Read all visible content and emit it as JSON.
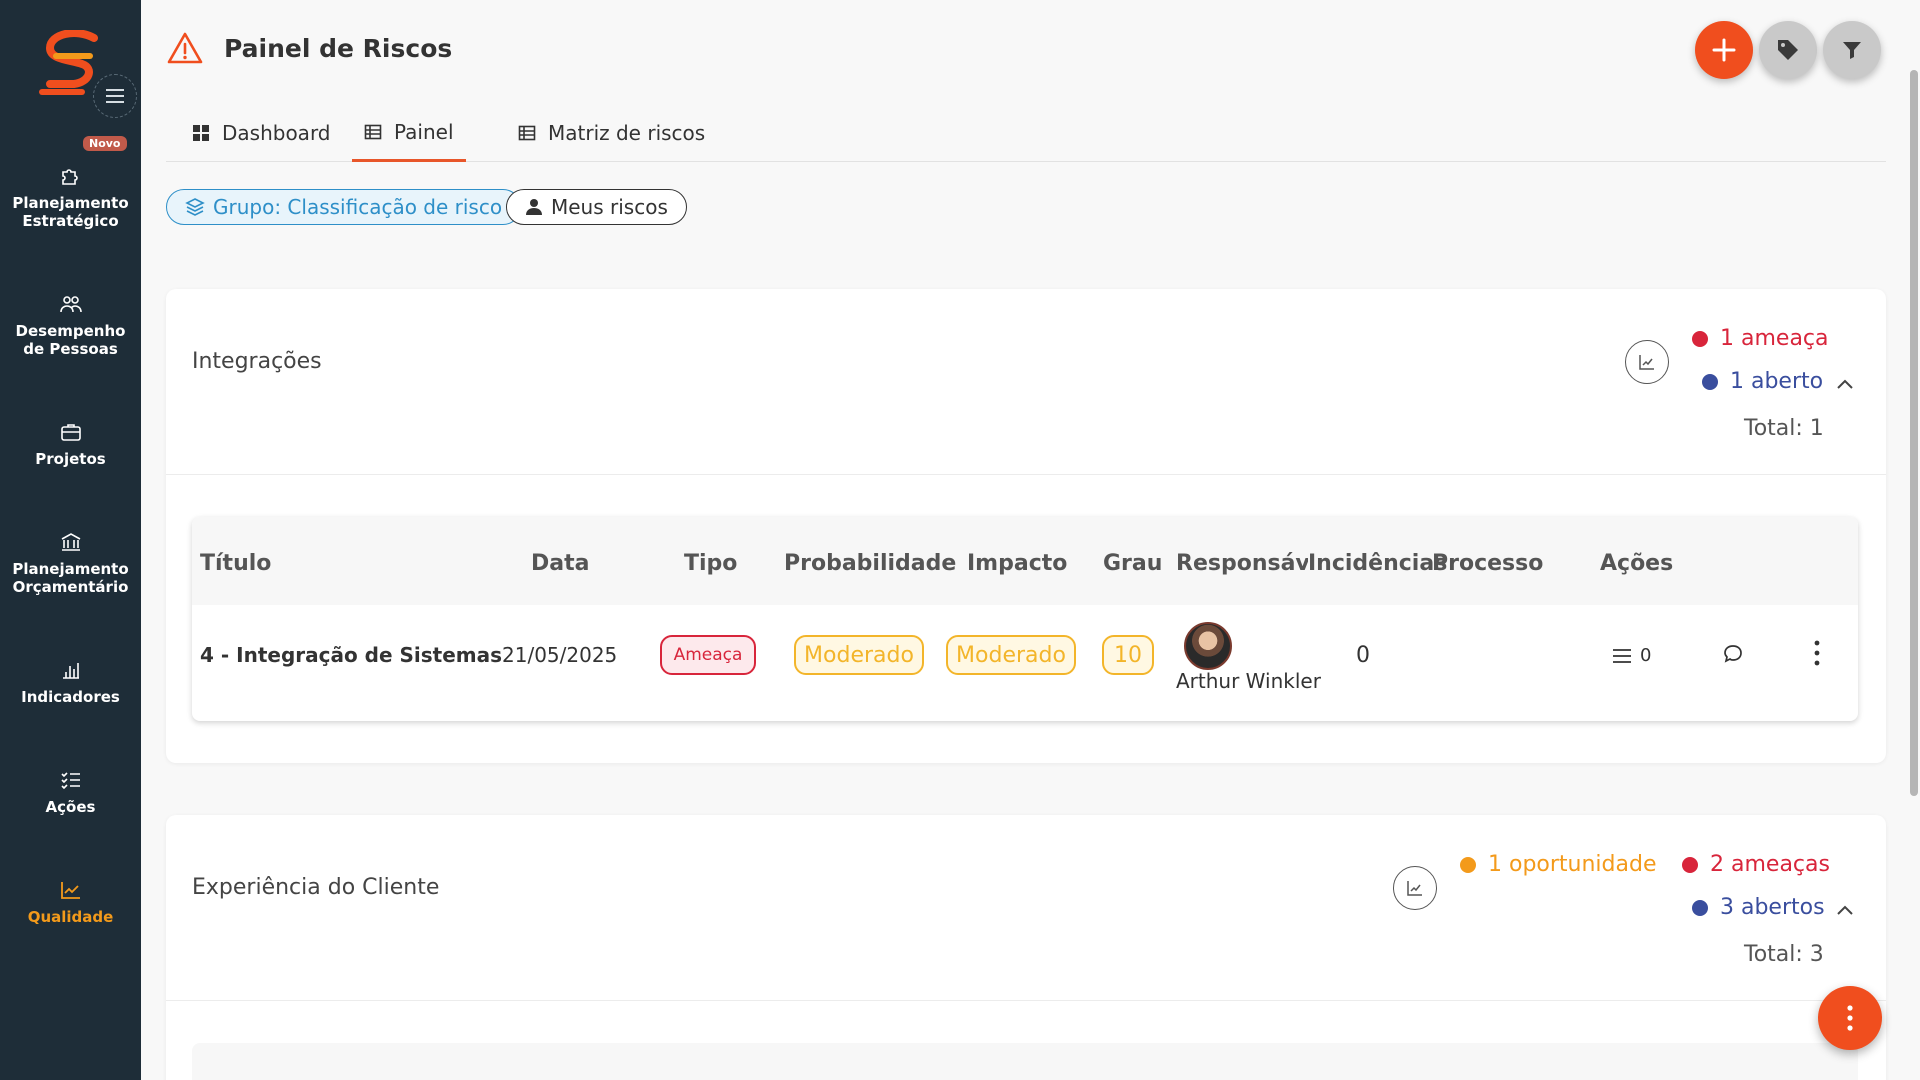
{
  "sidebar": {
    "badge": "Novo",
    "items": [
      {
        "label_l1": "Planejamento",
        "label_l2": "Estratégico",
        "icon": "puzzle-icon"
      },
      {
        "label_l1": "Desempenho",
        "label_l2": "de Pessoas",
        "icon": "people-icon"
      },
      {
        "label_l1": "Projetos",
        "label_l2": "",
        "icon": "briefcase-icon"
      },
      {
        "label_l1": "Planejamento",
        "label_l2": "Orçamentário",
        "icon": "bank-icon"
      },
      {
        "label_l1": "Indicadores",
        "label_l2": "",
        "icon": "bar-chart-icon"
      },
      {
        "label_l1": "Ações",
        "label_l2": "",
        "icon": "checklist-icon"
      },
      {
        "label_l1": "Qualidade",
        "label_l2": "",
        "icon": "line-chart-icon",
        "active": true
      }
    ]
  },
  "header": {
    "title": "Painel de Riscos"
  },
  "tabs": [
    {
      "label": "Dashboard"
    },
    {
      "label": "Painel",
      "active": true
    },
    {
      "label": "Matriz de riscos"
    }
  ],
  "chips": {
    "group": "Grupo: Classificação de risco",
    "mine": "Meus riscos"
  },
  "groups": [
    {
      "title": "Integrações",
      "threats": "1 ameaça",
      "open": "1 aberto",
      "total": "Total: 1",
      "table": {
        "headers": [
          "Título",
          "Data",
          "Tipo",
          "Probabilidade",
          "Impacto",
          "Grau",
          "Responsável",
          "Incidências",
          "Processo",
          "Ações"
        ],
        "rows": [
          {
            "title": "4 - Integração de Sistemas",
            "date": "21/05/2025",
            "type": "Ameaça",
            "probability": "Moderado",
            "impact": "Moderado",
            "grade": "10",
            "responsible": "Arthur Winkler",
            "incidences": "0",
            "actions_count": "0"
          }
        ]
      }
    },
    {
      "title": "Experiência do Cliente",
      "opportunities": "1 oportunidade",
      "threats": "2 ameaças",
      "open": "3 abertos",
      "total": "Total: 3"
    }
  ],
  "colors": {
    "accent": "#f04e1e",
    "sidebar_bg": "#1e2d38",
    "threat": "#d8253b",
    "open": "#3a4e9e",
    "opportunity": "#f39a1b",
    "moderate": "#f3b52a"
  }
}
